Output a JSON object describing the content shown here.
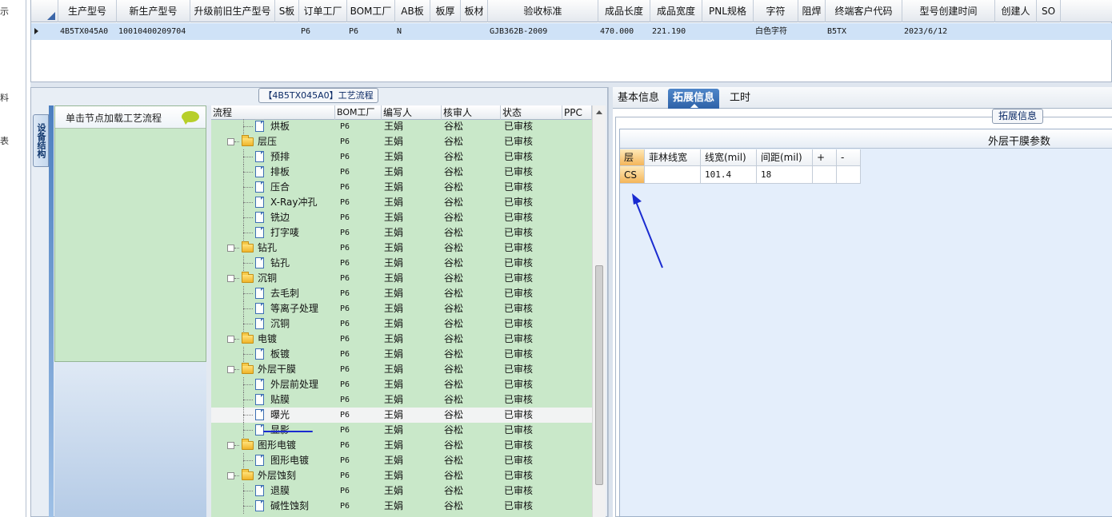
{
  "left_strip": {
    "glyphs": [
      "示",
      "料",
      "表"
    ]
  },
  "top_grid": {
    "columns": [
      "生产型号",
      "新生产型号",
      "升级前旧生产型号",
      "S板",
      "订单工厂",
      "BOM工厂",
      "AB板",
      "板厚",
      "板材",
      "验收标准",
      "成品长度",
      "成品宽度",
      "PNL规格",
      "字符",
      "阻焊",
      "终端客户代码",
      "型号创建时间",
      "创建人",
      "SO"
    ],
    "row": [
      "4B5TX045A0",
      "10010400209704",
      "",
      "",
      "P6",
      "P6",
      "N",
      "",
      "",
      "GJB362B-2009",
      "470.000",
      "221.190",
      "",
      "白色字符",
      "",
      "B5TX",
      "2023/6/12",
      "",
      ""
    ]
  },
  "process_panel": {
    "title": "【4B5TX045A0】工艺流程",
    "side_tab": "设备结构",
    "node_prompt": "单击节点加载工艺流程"
  },
  "tree": {
    "columns": [
      "流程",
      "BOM工厂",
      "编写人",
      "核审人",
      "状态",
      "PPC"
    ],
    "rows": [
      {
        "level": 2,
        "kind": "doc",
        "name": "烘板",
        "bom": "P6",
        "writer": "王娟",
        "reviewer": "谷松",
        "status": "已审核"
      },
      {
        "level": 1,
        "kind": "folder",
        "name": "层压",
        "bom": "P6",
        "writer": "王娟",
        "reviewer": "谷松",
        "status": "已审核"
      },
      {
        "level": 2,
        "kind": "doc",
        "name": "预排",
        "bom": "P6",
        "writer": "王娟",
        "reviewer": "谷松",
        "status": "已审核"
      },
      {
        "level": 2,
        "kind": "doc",
        "name": "排板",
        "bom": "P6",
        "writer": "王娟",
        "reviewer": "谷松",
        "status": "已审核"
      },
      {
        "level": 2,
        "kind": "doc",
        "name": "压合",
        "bom": "P6",
        "writer": "王娟",
        "reviewer": "谷松",
        "status": "已审核"
      },
      {
        "level": 2,
        "kind": "doc",
        "name": "X-Ray冲孔",
        "bom": "P6",
        "writer": "王娟",
        "reviewer": "谷松",
        "status": "已审核"
      },
      {
        "level": 2,
        "kind": "doc",
        "name": "铣边",
        "bom": "P6",
        "writer": "王娟",
        "reviewer": "谷松",
        "status": "已审核"
      },
      {
        "level": 2,
        "kind": "doc",
        "name": "打字唛",
        "bom": "P6",
        "writer": "王娟",
        "reviewer": "谷松",
        "status": "已审核"
      },
      {
        "level": 1,
        "kind": "folder",
        "name": "钻孔",
        "bom": "P6",
        "writer": "王娟",
        "reviewer": "谷松",
        "status": "已审核"
      },
      {
        "level": 2,
        "kind": "doc",
        "name": "钻孔",
        "bom": "P6",
        "writer": "王娟",
        "reviewer": "谷松",
        "status": "已审核"
      },
      {
        "level": 1,
        "kind": "folder",
        "name": "沉铜",
        "bom": "P6",
        "writer": "王娟",
        "reviewer": "谷松",
        "status": "已审核"
      },
      {
        "level": 2,
        "kind": "doc",
        "name": "去毛刺",
        "bom": "P6",
        "writer": "王娟",
        "reviewer": "谷松",
        "status": "已审核"
      },
      {
        "level": 2,
        "kind": "doc",
        "name": "等离子处理",
        "bom": "P6",
        "writer": "王娟",
        "reviewer": "谷松",
        "status": "已审核"
      },
      {
        "level": 2,
        "kind": "doc",
        "name": "沉铜",
        "bom": "P6",
        "writer": "王娟",
        "reviewer": "谷松",
        "status": "已审核"
      },
      {
        "level": 1,
        "kind": "folder",
        "name": "电镀",
        "bom": "P6",
        "writer": "王娟",
        "reviewer": "谷松",
        "status": "已审核"
      },
      {
        "level": 2,
        "kind": "doc",
        "name": "板镀",
        "bom": "P6",
        "writer": "王娟",
        "reviewer": "谷松",
        "status": "已审核"
      },
      {
        "level": 1,
        "kind": "folder",
        "name": "外层干膜",
        "bom": "P6",
        "writer": "王娟",
        "reviewer": "谷松",
        "status": "已审核"
      },
      {
        "level": 2,
        "kind": "doc",
        "name": "外层前处理",
        "bom": "P6",
        "writer": "王娟",
        "reviewer": "谷松",
        "status": "已审核"
      },
      {
        "level": 2,
        "kind": "doc",
        "name": "贴膜",
        "bom": "P6",
        "writer": "王娟",
        "reviewer": "谷松",
        "status": "已审核"
      },
      {
        "level": 2,
        "kind": "doc",
        "name": "曝光",
        "bom": "P6",
        "writer": "王娟",
        "reviewer": "谷松",
        "status": "已审核",
        "selected": true
      },
      {
        "level": 2,
        "kind": "doc",
        "name": "显影",
        "bom": "P6",
        "writer": "王娟",
        "reviewer": "谷松",
        "status": "已审核"
      },
      {
        "level": 1,
        "kind": "folder",
        "name": "图形电镀",
        "bom": "P6",
        "writer": "王娟",
        "reviewer": "谷松",
        "status": "已审核"
      },
      {
        "level": 2,
        "kind": "doc",
        "name": "图形电镀",
        "bom": "P6",
        "writer": "王娟",
        "reviewer": "谷松",
        "status": "已审核"
      },
      {
        "level": 1,
        "kind": "folder",
        "name": "外层蚀刻",
        "bom": "P6",
        "writer": "王娟",
        "reviewer": "谷松",
        "status": "已审核"
      },
      {
        "level": 2,
        "kind": "doc",
        "name": "退膜",
        "bom": "P6",
        "writer": "王娟",
        "reviewer": "谷松",
        "status": "已审核"
      },
      {
        "level": 2,
        "kind": "doc",
        "name": "碱性蚀刻",
        "bom": "P6",
        "writer": "王娟",
        "reviewer": "谷松",
        "status": "已审核"
      }
    ]
  },
  "right_panel": {
    "tabs": [
      "基本信息",
      "拓展信息",
      "工时"
    ],
    "active_tab": 1,
    "group_title": "拓展信息",
    "grid_caption": "外层干膜参数",
    "param_columns": [
      "层",
      "菲林线宽",
      "线宽(mil)",
      "间距(mil)",
      "+",
      "-"
    ],
    "param_row": [
      "CS",
      "",
      "101.4",
      "18",
      "",
      ""
    ]
  },
  "colors": {
    "tree_bg": "#c9e8c9",
    "selection": "#cfe2f7",
    "active_tab": "#2e62a8",
    "annotation": "#1a2bd0"
  }
}
